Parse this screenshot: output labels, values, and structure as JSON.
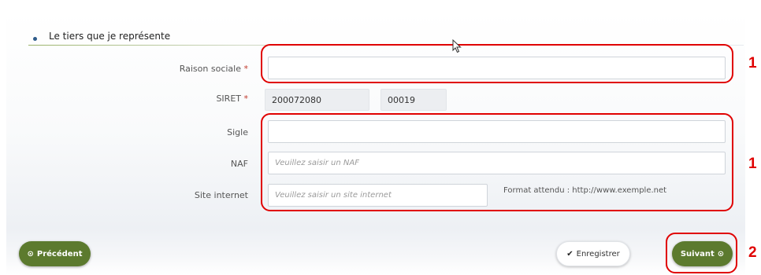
{
  "section": {
    "title": "Le tiers que je représente"
  },
  "fields": {
    "raison_sociale": {
      "label": "Raison sociale",
      "required": "*",
      "value": ""
    },
    "siret": {
      "label": "SIRET",
      "required": "*",
      "part1": "200072080",
      "part2": "00019"
    },
    "sigle": {
      "label": "Sigle",
      "value": ""
    },
    "naf": {
      "label": "NAF",
      "placeholder": "Veuillez saisir un NAF"
    },
    "site": {
      "label": "Site internet",
      "placeholder": "Veuillez saisir un site internet",
      "hint": "Format attendu : http://www.exemple.net"
    }
  },
  "annotations": {
    "n1a": "1",
    "n1b": "1",
    "n2": "2"
  },
  "buttons": {
    "previous": "Précédent",
    "save": "Enregistrer",
    "next": "Suivant"
  },
  "icons": {
    "previous": "circle-arrow-left-icon",
    "save": "check-circle-icon",
    "next": "circle-arrow-right-icon"
  },
  "colors": {
    "accent_green": "#5c7a2e",
    "annotation_red": "#e00000",
    "required_red": "#c0392b"
  }
}
